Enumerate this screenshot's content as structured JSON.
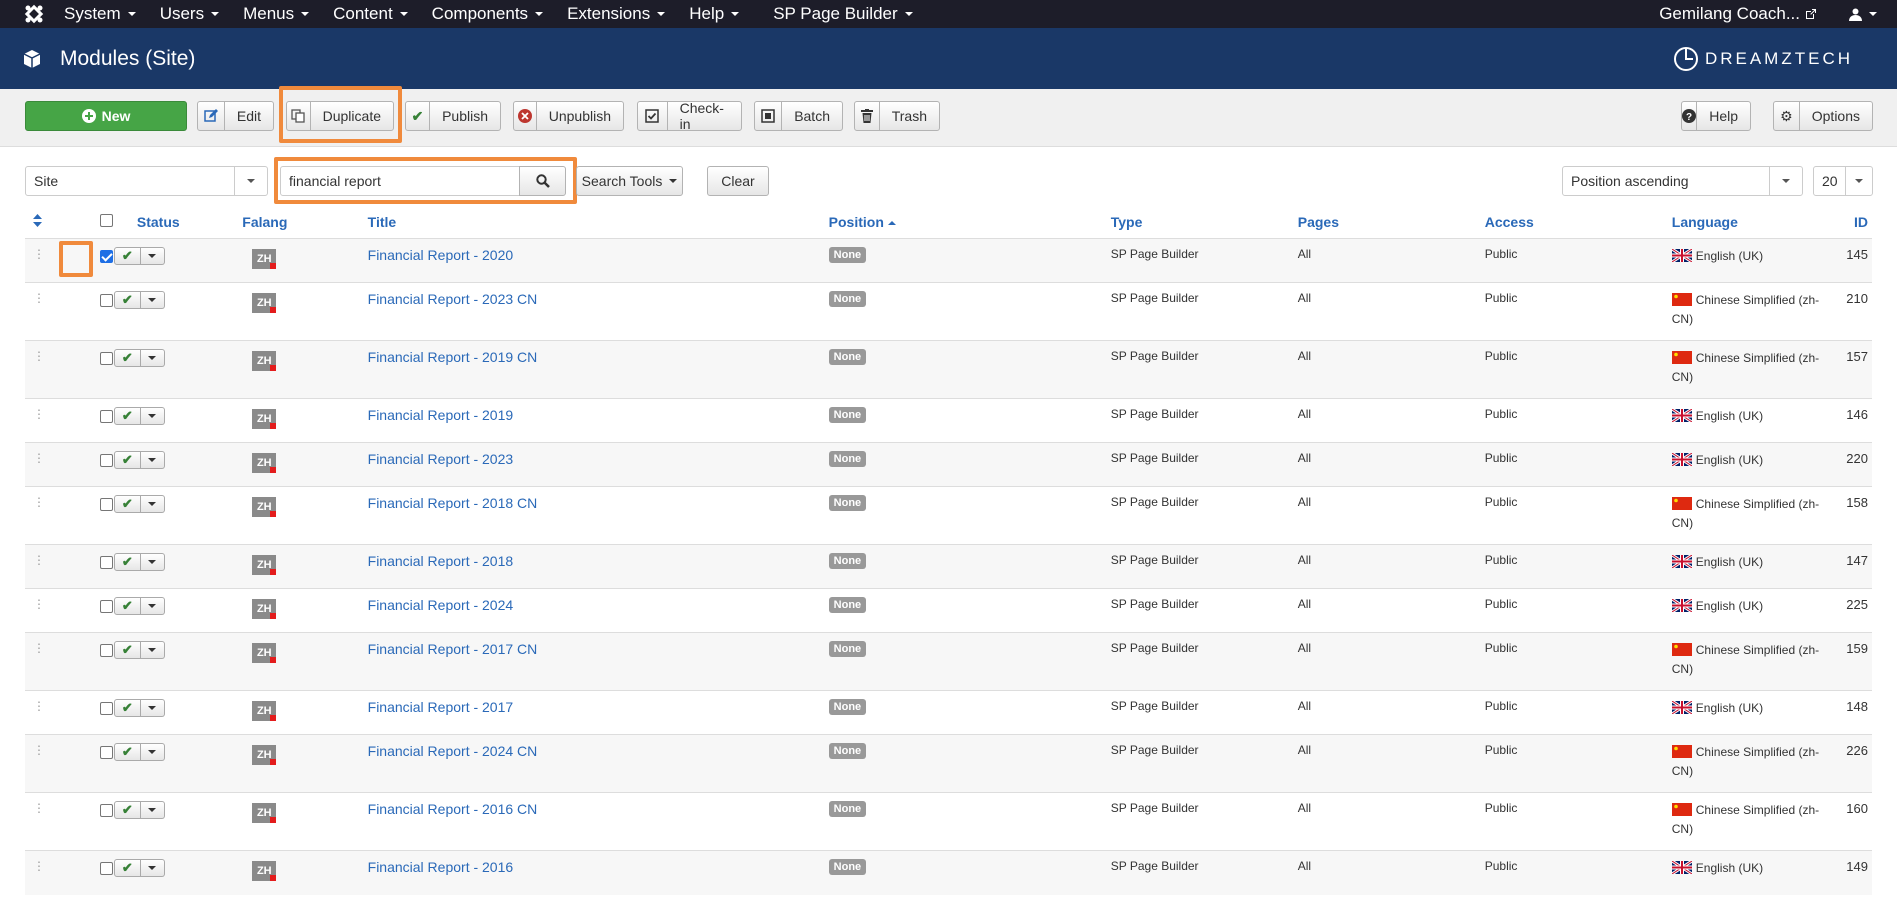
{
  "nav": {
    "menus": [
      "System",
      "Users",
      "Menus",
      "Content",
      "Components",
      "Extensions",
      "Help",
      "SP Page Builder"
    ],
    "site_name": "Gemilang Coach..."
  },
  "header": {
    "title": "Modules (Site)",
    "brand": "DREAMZTECH"
  },
  "toolbar": {
    "new": "New",
    "edit": "Edit",
    "duplicate": "Duplicate",
    "publish": "Publish",
    "unpublish": "Unpublish",
    "checkin": "Check-in",
    "batch": "Batch",
    "trash": "Trash",
    "help": "Help",
    "options": "Options"
  },
  "filters": {
    "client": "Site",
    "search_value": "financial report",
    "search_tools": "Search Tools",
    "clear": "Clear",
    "sort": "Position ascending",
    "limit": "20"
  },
  "columns": {
    "status": "Status",
    "falang": "Falang",
    "title": "Title",
    "position": "Position",
    "type": "Type",
    "pages": "Pages",
    "access": "Access",
    "language": "Language",
    "id": "ID"
  },
  "rows": [
    {
      "title": "Financial Report - 2020",
      "position": "None",
      "type": "SP Page Builder",
      "pages": "All",
      "access": "Public",
      "language": "English (UK)",
      "id": "145",
      "checked": true
    },
    {
      "title": "Financial Report - 2023 CN",
      "position": "None",
      "type": "SP Page Builder",
      "pages": "All",
      "access": "Public",
      "language": "Chinese Simplified (zh-CN)",
      "id": "210"
    },
    {
      "title": "Financial Report - 2019 CN",
      "position": "None",
      "type": "SP Page Builder",
      "pages": "All",
      "access": "Public",
      "language": "Chinese Simplified (zh-CN)",
      "id": "157"
    },
    {
      "title": "Financial Report - 2019",
      "position": "None",
      "type": "SP Page Builder",
      "pages": "All",
      "access": "Public",
      "language": "English (UK)",
      "id": "146"
    },
    {
      "title": "Financial Report - 2023",
      "position": "None",
      "type": "SP Page Builder",
      "pages": "All",
      "access": "Public",
      "language": "English (UK)",
      "id": "220"
    },
    {
      "title": "Financial Report - 2018 CN",
      "position": "None",
      "type": "SP Page Builder",
      "pages": "All",
      "access": "Public",
      "language": "Chinese Simplified (zh-CN)",
      "id": "158"
    },
    {
      "title": "Financial Report - 2018",
      "position": "None",
      "type": "SP Page Builder",
      "pages": "All",
      "access": "Public",
      "language": "English (UK)",
      "id": "147"
    },
    {
      "title": "Financial Report - 2024",
      "position": "None",
      "type": "SP Page Builder",
      "pages": "All",
      "access": "Public",
      "language": "English (UK)",
      "id": "225"
    },
    {
      "title": "Financial Report - 2017 CN",
      "position": "None",
      "type": "SP Page Builder",
      "pages": "All",
      "access": "Public",
      "language": "Chinese Simplified (zh-CN)",
      "id": "159"
    },
    {
      "title": "Financial Report - 2017",
      "position": "None",
      "type": "SP Page Builder",
      "pages": "All",
      "access": "Public",
      "language": "English (UK)",
      "id": "148"
    },
    {
      "title": "Financial Report - 2024 CN",
      "position": "None",
      "type": "SP Page Builder",
      "pages": "All",
      "access": "Public",
      "language": "Chinese Simplified (zh-CN)",
      "id": "226"
    },
    {
      "title": "Financial Report - 2016 CN",
      "position": "None",
      "type": "SP Page Builder",
      "pages": "All",
      "access": "Public",
      "language": "Chinese Simplified (zh-CN)",
      "id": "160"
    },
    {
      "title": "Financial Report - 2016",
      "position": "None",
      "type": "SP Page Builder",
      "pages": "All",
      "access": "Public",
      "language": "English (UK)",
      "id": "149"
    }
  ],
  "falang_badge": "ZH"
}
